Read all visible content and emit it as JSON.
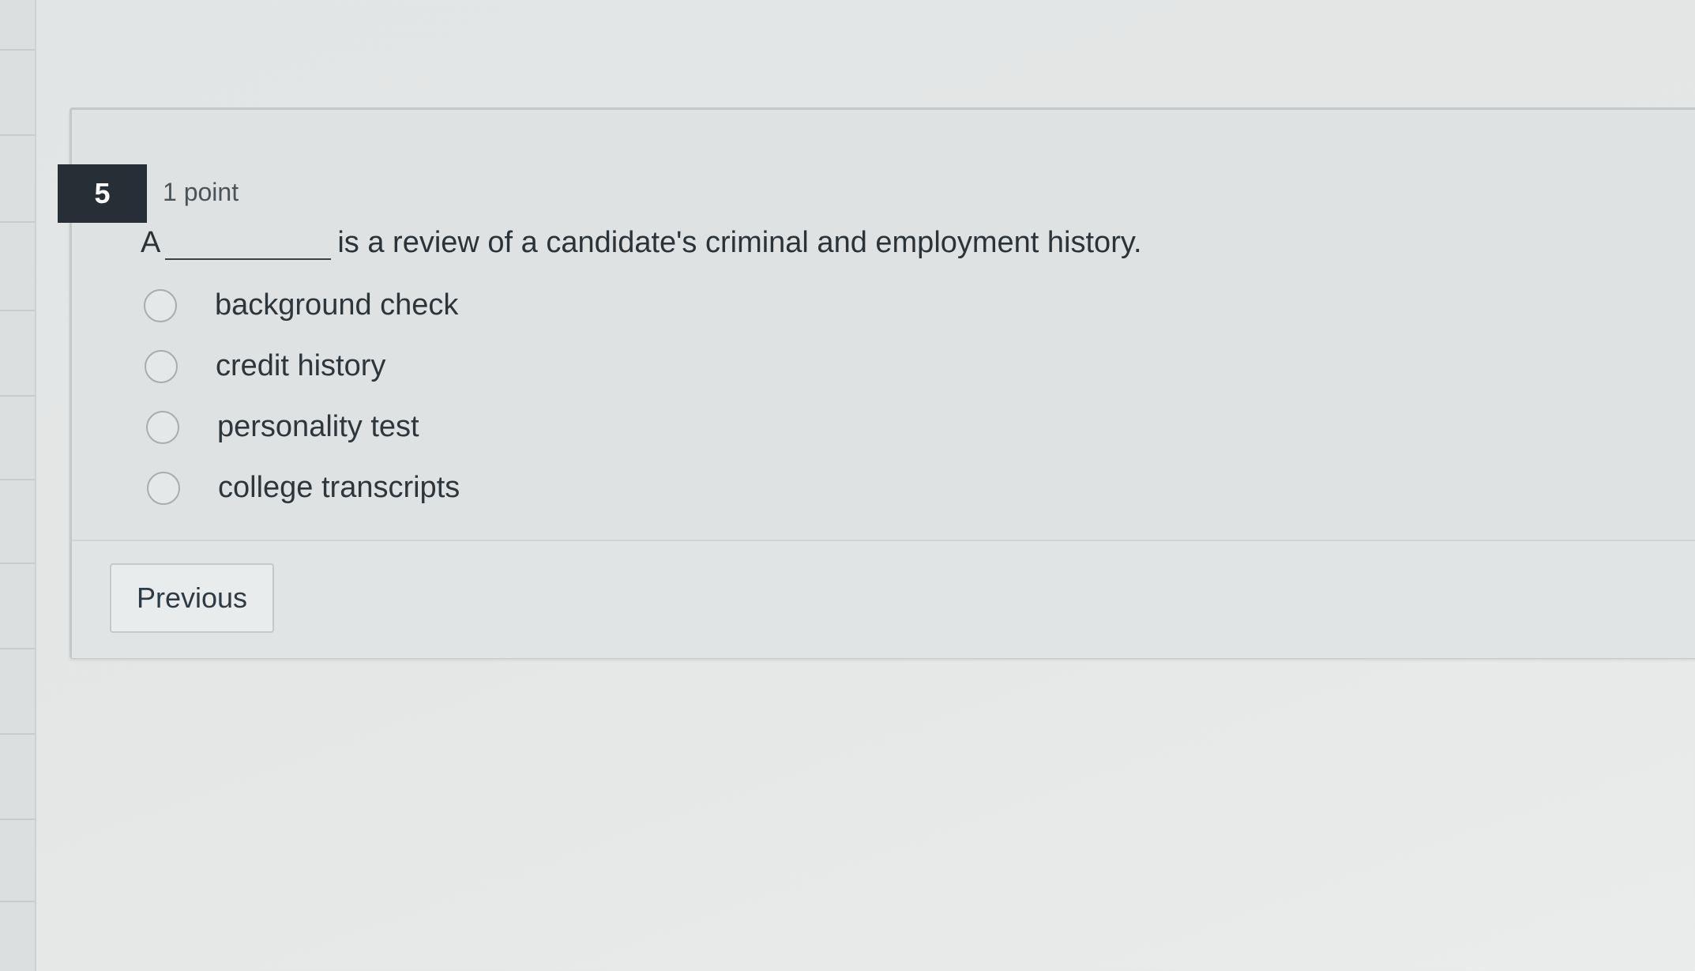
{
  "question": {
    "number": "5",
    "points": "1 point",
    "prompt_before": "A",
    "prompt_after": "is a review of a candidate's criminal and employment history."
  },
  "options": [
    {
      "label": "background check"
    },
    {
      "label": "credit history"
    },
    {
      "label": "personality test"
    },
    {
      "label": "college transcripts"
    }
  ],
  "navigation": {
    "previous_label": "Previous"
  },
  "icons": {
    "radio": "radio-unchecked-icon"
  },
  "colors": {
    "question_badge": "#272f36",
    "text": "#2d3b45",
    "radio_border": "#a6adb1"
  }
}
